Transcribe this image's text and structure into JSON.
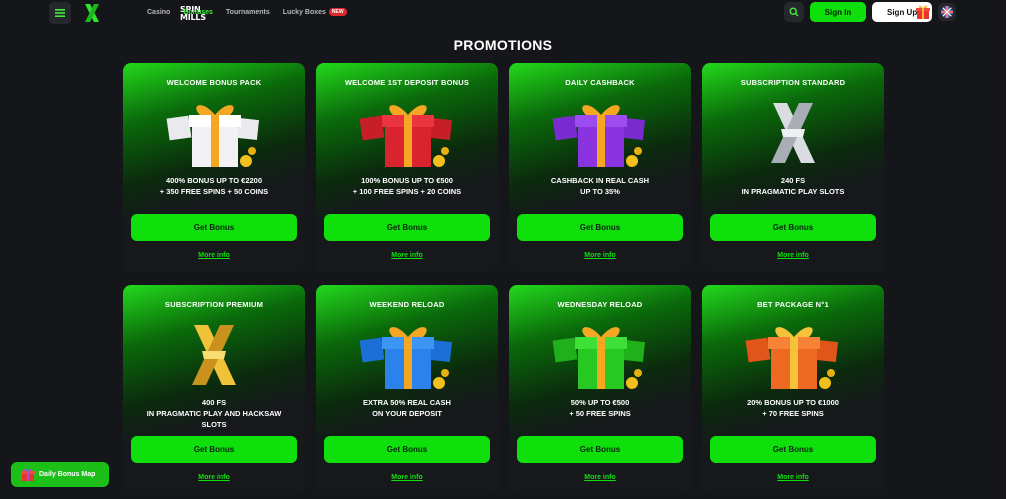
{
  "header": {
    "logo_line1": "SPIN",
    "logo_line2": "MILLS",
    "nav": [
      {
        "label": "Casino",
        "active": false
      },
      {
        "label": "Bonuses",
        "active": true
      },
      {
        "label": "Tournaments",
        "active": false
      },
      {
        "label": "Lucky Boxes",
        "active": false,
        "badge": "NEW"
      }
    ],
    "signin_label": "Sign In",
    "signup_label": "Sign Up"
  },
  "page_title": "PROMOTIONS",
  "colors": {
    "accent": "#0fe00b",
    "background": "#15161a",
    "badge": "#e0282e"
  },
  "promotions": [
    {
      "title": "WELCOME BONUS PACK",
      "description": "400% BONUS UP TO €2200\n+ 350 FREE SPINS + 50 COINS",
      "button": "Get Bonus",
      "link": "More info",
      "art": "white-gift-icon"
    },
    {
      "title": "WELCOME 1ST DEPOSIT BONUS",
      "description": "100% BONUS UP TO €500\n+ 100 FREE SPINS + 20 COINS",
      "button": "Get Bonus",
      "link": "More info",
      "art": "red-gift-icon"
    },
    {
      "title": "DAILY CASHBACK",
      "description": "CASHBACK IN REAL CASH\nUP TO 35%",
      "button": "Get Bonus",
      "link": "More info",
      "art": "purple-gift-icon"
    },
    {
      "title": "SUBSCRIPTION STANDARD",
      "description": "240 FS\nIN PRAGMATIC PLAY SLOTS",
      "button": "Get Bonus",
      "link": "More info",
      "art": "silver-x-icon"
    },
    {
      "title": "SUBSCRIPTION PREMIUM",
      "description": "400 FS\nIN PRAGMATIC PLAY AND HACKSAW\nSLOTS",
      "button": "Get Bonus",
      "link": "More info",
      "art": "gold-x-icon"
    },
    {
      "title": "WEEKEND RELOAD",
      "description": "EXTRA 50% REAL CASH\nON YOUR DEPOSIT",
      "button": "Get Bonus",
      "link": "More info",
      "art": "blue-gift-icon"
    },
    {
      "title": "WEDNESDAY RELOAD",
      "description": "50% UP TO €500\n+ 50 FREE SPINS",
      "button": "Get Bonus",
      "link": "More info",
      "art": "green-gift-icon"
    },
    {
      "title": "BET PACKAGE N°1",
      "description": "20% BONUS UP TO €1000\n+ 70 FREE SPINS",
      "button": "Get Bonus",
      "link": "More info",
      "art": "orange-gift-icon"
    }
  ],
  "daily_bonus_map": "Daily Bonus Map"
}
